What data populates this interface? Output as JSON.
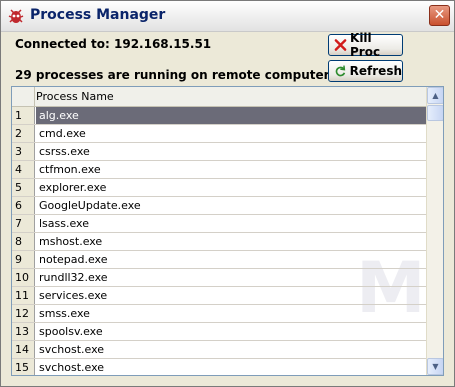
{
  "window": {
    "title": "Process Manager",
    "app_icon": "bug-icon",
    "close_label": "✕"
  },
  "status": {
    "connected": "Connected to: 192.168.15.51",
    "process_count": "29 processes are running on remote computer"
  },
  "buttons": {
    "kill": {
      "label": "Kill Proc",
      "icon": "red-x-icon"
    },
    "refresh": {
      "label": "Refresh",
      "icon": "refresh-icon"
    }
  },
  "table": {
    "header": {
      "col0": "",
      "col1": "Process Name"
    },
    "selected_row": 1,
    "rows": [
      {
        "num": "1",
        "name": "alg.exe"
      },
      {
        "num": "2",
        "name": "cmd.exe"
      },
      {
        "num": "3",
        "name": "csrss.exe"
      },
      {
        "num": "4",
        "name": "ctfmon.exe"
      },
      {
        "num": "5",
        "name": "explorer.exe"
      },
      {
        "num": "6",
        "name": "GoogleUpdate.exe"
      },
      {
        "num": "7",
        "name": "lsass.exe"
      },
      {
        "num": "8",
        "name": "mshost.exe"
      },
      {
        "num": "9",
        "name": "notepad.exe"
      },
      {
        "num": "10",
        "name": "rundll32.exe"
      },
      {
        "num": "11",
        "name": "services.exe"
      },
      {
        "num": "12",
        "name": "smss.exe"
      },
      {
        "num": "13",
        "name": "spoolsv.exe"
      },
      {
        "num": "14",
        "name": "svchost.exe"
      },
      {
        "num": "15",
        "name": "svchost.exe"
      }
    ]
  },
  "colors": {
    "selection": "#6B6B78",
    "title_text": "#0A246A"
  }
}
